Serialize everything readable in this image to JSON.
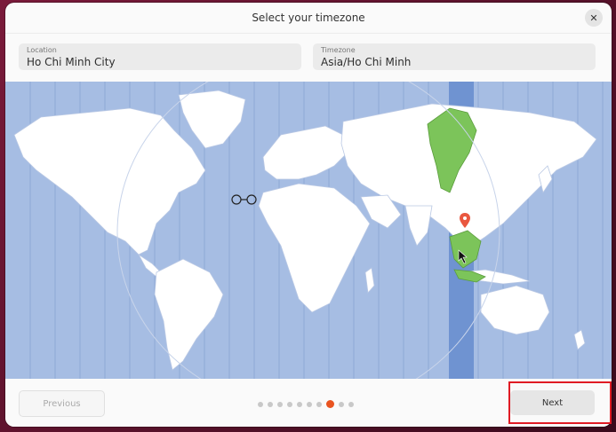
{
  "window": {
    "title": "Select your timezone",
    "close_icon": "close-icon"
  },
  "location": {
    "label": "Location",
    "value": "Ho Chi Minh City"
  },
  "timezone": {
    "label": "Timezone",
    "value": "Asia/Ho Chi Minh"
  },
  "map": {
    "selected_zone_color": "#7cc45a",
    "ocean_color": "#a6bde3",
    "land_color": "#ffffff",
    "highlight_band_color": "#6f93d1",
    "pin_icon": "map-pin-icon",
    "pin_color": "#e9573f"
  },
  "footer": {
    "previous_label": "Previous",
    "next_label": "Next",
    "step_count": 10,
    "active_step": 8,
    "accent_color": "#e95420"
  }
}
